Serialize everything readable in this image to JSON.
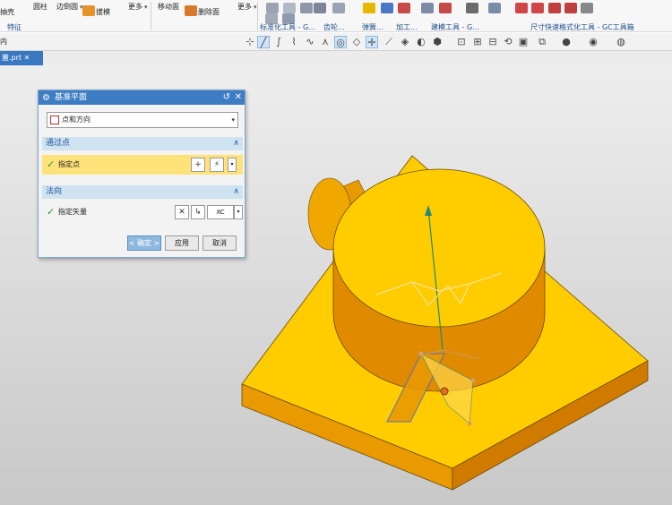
{
  "ribbon": {
    "items": [
      {
        "label": "抽壳"
      },
      {
        "label": "圆柱"
      },
      {
        "label": "边倒圆"
      },
      {
        "label": "拔模"
      },
      {
        "label": "更多"
      },
      {
        "label": "移动面"
      },
      {
        "label": "删除面"
      },
      {
        "label": "更多"
      }
    ],
    "groups": [
      {
        "label": "特征"
      },
      {
        "label": "标准化工具 - G..."
      },
      {
        "label": "齿轮..."
      },
      {
        "label": "弹簧..."
      },
      {
        "label": "加工..."
      },
      {
        "label": "建模工具 - G..."
      },
      {
        "label": "尺寸快速格式化工具 - GC工具箱"
      }
    ]
  },
  "toolbar2": {
    "left_field": "内"
  },
  "file_tab": {
    "label": "蓋.prt"
  },
  "dialog": {
    "title": "基准平面",
    "type_value": "点和方向",
    "section_point": "通过点",
    "specify_point": "指定点",
    "section_normal": "法向",
    "specify_vector": "指定矢量",
    "vector_button": "XC",
    "ok": "< 确定 >",
    "apply": "应用",
    "cancel": "取消"
  },
  "colors": {
    "model_top": "#ffcc00",
    "model_side": "#e08a00",
    "dialog_title": "#3e7dc4",
    "section_header": "#cfe3f1",
    "highlight_row": "#ffe27a"
  }
}
